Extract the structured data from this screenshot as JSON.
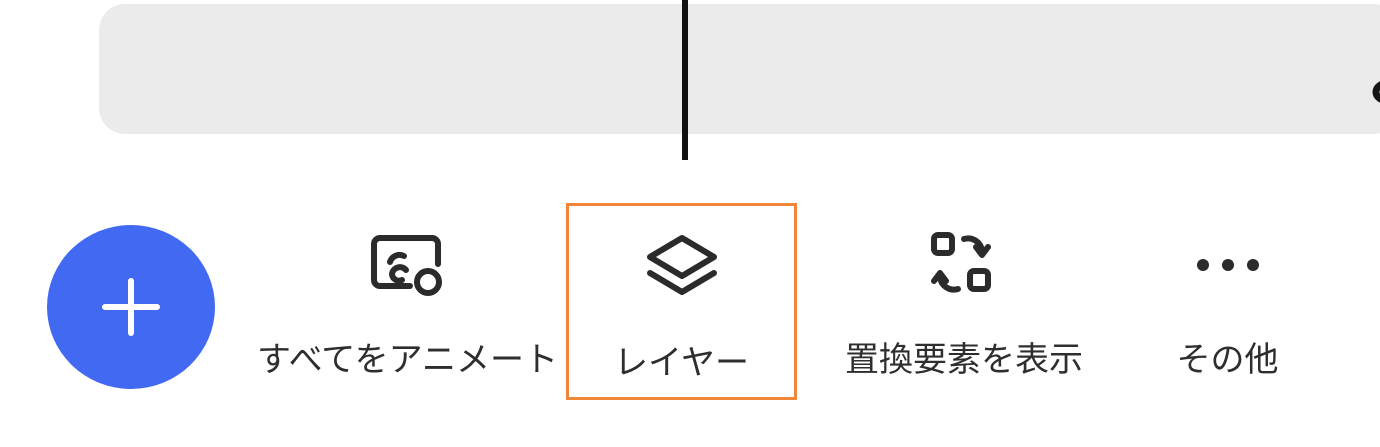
{
  "timeline": {
    "audio_track": {
      "add_music_icon": "music-note-plus-icon"
    }
  },
  "fab": {
    "icon": "plus-icon",
    "color": "#4169f1"
  },
  "toolbar": {
    "animate_all": {
      "label": "すべてをアニメート",
      "icon": "image-animate-icon"
    },
    "layer": {
      "label": "レイヤー",
      "icon": "layers-icon",
      "highlight_color": "#f0863a"
    },
    "show_replace": {
      "label": "置換要素を表示",
      "icon": "swap-elements-icon"
    },
    "more": {
      "label": "その他",
      "icon": "more-dots-icon"
    }
  }
}
